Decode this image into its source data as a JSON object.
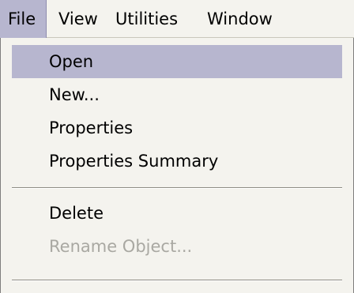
{
  "menubar": {
    "items": [
      {
        "label": "File",
        "active": true
      },
      {
        "label": "View",
        "active": false
      },
      {
        "label": "Utilities",
        "active": false
      },
      {
        "label": "Window",
        "active": false
      }
    ]
  },
  "dropdown": {
    "items": [
      {
        "label": "Open",
        "highlighted": true,
        "enabled": true
      },
      {
        "label": "New...",
        "highlighted": false,
        "enabled": true
      },
      {
        "label": "Properties",
        "highlighted": false,
        "enabled": true
      },
      {
        "label": "Properties Summary",
        "highlighted": false,
        "enabled": true
      },
      {
        "label": "Delete",
        "highlighted": false,
        "enabled": true
      },
      {
        "label": "Rename Object...",
        "highlighted": false,
        "enabled": false
      }
    ]
  },
  "colors": {
    "menu_background": "#f4f3ee",
    "highlight": "#b7b6cf",
    "disabled_text": "#a9a8a2",
    "separator": "#8f8d85"
  }
}
